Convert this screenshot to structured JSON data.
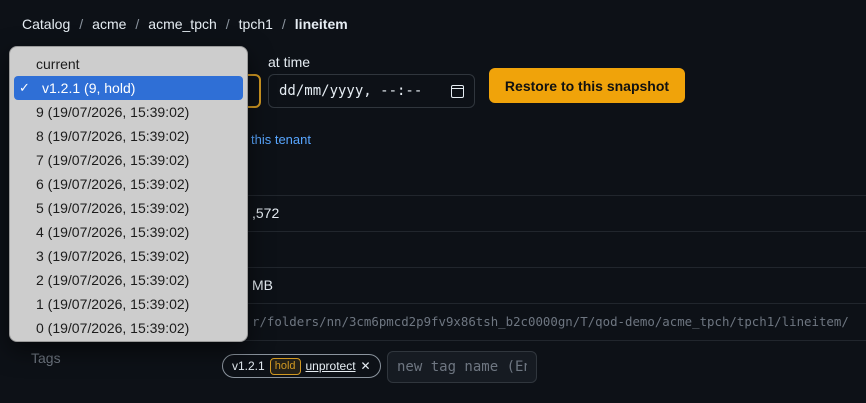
{
  "breadcrumb": [
    "Catalog",
    "acme",
    "acme_tpch",
    "tpch1",
    "lineitem"
  ],
  "snapshot_form": {
    "at_time_label": "at time",
    "date_placeholder": "dd/mm/yyyy, --:--",
    "restore_button": "Restore to this snapshot"
  },
  "tenant_link": "this tenant",
  "table_info": {
    "rows_value": ",572",
    "size_value": "MB",
    "path_value": "r/folders/nn/3cm6pmcd2p9fv9x86tsh_b2c0000gn/T/qod-demo/acme_tpch/tpch1/lineitem/"
  },
  "tags": {
    "label": "Tags",
    "chip_name": "v1.2.1",
    "chip_badge": "hold",
    "chip_action": "unprotect",
    "new_tag_placeholder": "new tag name (Enter)"
  },
  "snapshot_dropdown": {
    "selected_index": 1,
    "options": [
      "current",
      "v1.2.1 (9, hold)",
      "9 (19/07/2026, 15:39:02)",
      "8 (19/07/2026, 15:39:02)",
      "7 (19/07/2026, 15:39:02)",
      "6 (19/07/2026, 15:39:02)",
      "5 (19/07/2026, 15:39:02)",
      "4 (19/07/2026, 15:39:02)",
      "3 (19/07/2026, 15:39:02)",
      "2 (19/07/2026, 15:39:02)",
      "1 (19/07/2026, 15:39:02)",
      "0 (19/07/2026, 15:39:02)"
    ]
  },
  "colors": {
    "accent": "#f0a30a",
    "link": "#58a6ff",
    "selected_option": "#2f6fd6",
    "background": "#0d1117"
  }
}
